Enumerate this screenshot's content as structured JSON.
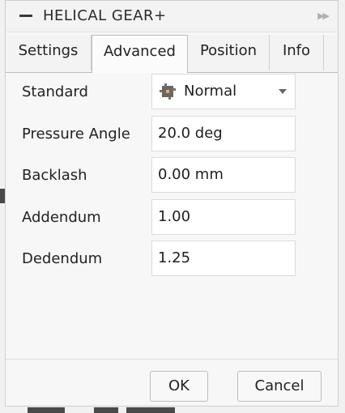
{
  "titlebar": {
    "title": "HELICAL GEAR+",
    "collapse_icon": "minus-icon",
    "expand_icon": "double-chevron-right-icon"
  },
  "tabs": [
    {
      "label": "Settings",
      "active": false
    },
    {
      "label": "Advanced",
      "active": true
    },
    {
      "label": "Position",
      "active": false
    },
    {
      "label": "Info",
      "active": false
    }
  ],
  "form": {
    "standard": {
      "label": "Standard",
      "value": "Normal",
      "icon": "gear-icon"
    },
    "pressure_angle": {
      "label": "Pressure Angle",
      "value": "20.0 deg"
    },
    "backlash": {
      "label": "Backlash",
      "value": "0.00 mm"
    },
    "addendum": {
      "label": "Addendum",
      "value": "1.00"
    },
    "dedendum": {
      "label": "Dedendum",
      "value": "1.25"
    }
  },
  "footer": {
    "ok_label": "OK",
    "cancel_label": "Cancel"
  }
}
